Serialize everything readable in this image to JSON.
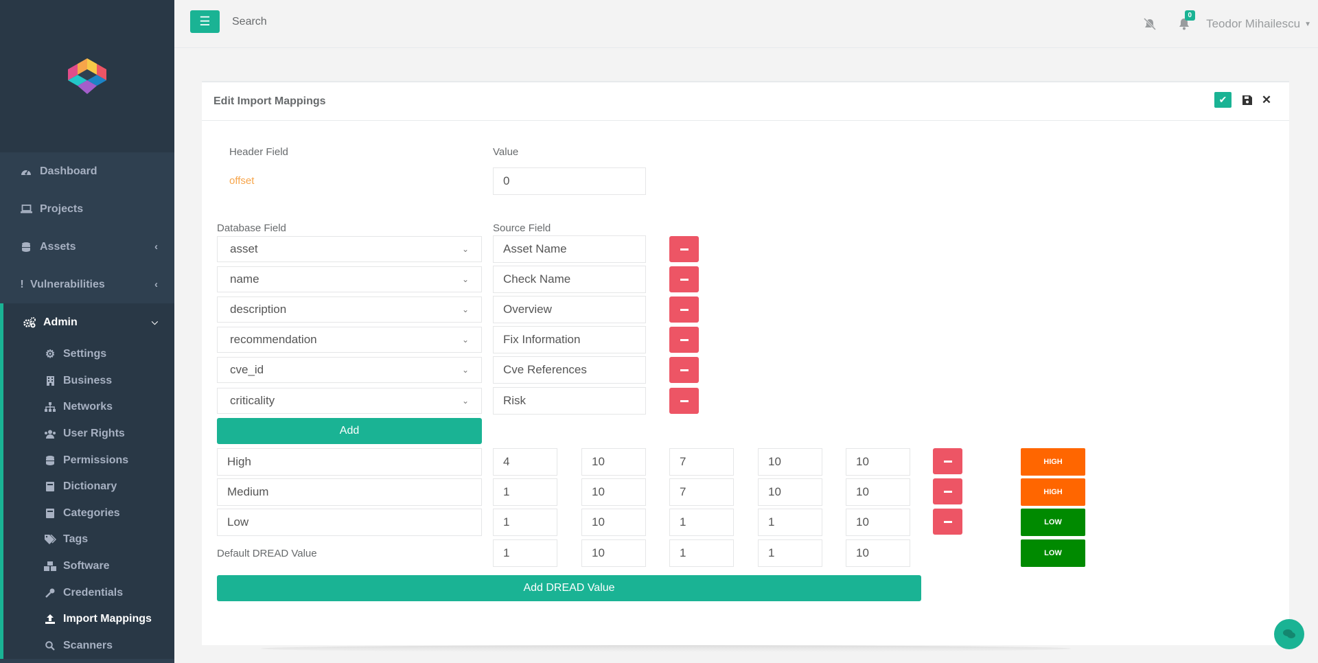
{
  "topbar": {
    "search": "Search",
    "notification_count": "0",
    "user_name": "Teodor Mihailescu"
  },
  "sidebar": {
    "items": [
      {
        "label": "Dashboard",
        "icon": "dashboard-icon"
      },
      {
        "label": "Projects",
        "icon": "laptop-icon"
      },
      {
        "label": "Assets",
        "icon": "database-icon"
      },
      {
        "label": "Vulnerabilities",
        "icon": "exclamation-icon"
      },
      {
        "label": "Admin",
        "icon": "gears-icon"
      }
    ],
    "admin_items": [
      {
        "label": "Settings",
        "icon": "gears-icon"
      },
      {
        "label": "Business",
        "icon": "building-icon"
      },
      {
        "label": "Networks",
        "icon": "sitemap-icon"
      },
      {
        "label": "User Rights",
        "icon": "users-icon"
      },
      {
        "label": "Permissions",
        "icon": "database-icon"
      },
      {
        "label": "Dictionary",
        "icon": "book-icon"
      },
      {
        "label": "Categories",
        "icon": "book-icon"
      },
      {
        "label": "Tags",
        "icon": "tags-icon"
      },
      {
        "label": "Software",
        "icon": "cubes-icon"
      },
      {
        "label": "Credentials",
        "icon": "key-icon"
      },
      {
        "label": "Import Mappings",
        "icon": "upload-icon"
      },
      {
        "label": "Scanners",
        "icon": "search-icon"
      }
    ]
  },
  "panel": {
    "title": "Edit Import Mappings",
    "header_field_label": "Header Field",
    "value_label": "Value",
    "header_field": "offset",
    "header_value": "0",
    "database_field_label": "Database Field",
    "source_field_label": "Source Field",
    "mappings": [
      {
        "db": "asset",
        "source": "Asset Name"
      },
      {
        "db": "name",
        "source": "Check Name"
      },
      {
        "db": "description",
        "source": "Overview"
      },
      {
        "db": "recommendation",
        "source": "Fix Information"
      },
      {
        "db": "cve_id",
        "source": "Cve References"
      },
      {
        "db": "criticality",
        "source": "Risk"
      }
    ],
    "add_label": "Add",
    "dread": [
      {
        "name": "High",
        "v": [
          "4",
          "10",
          "7",
          "10",
          "10"
        ],
        "level": "HIGH"
      },
      {
        "name": "Medium",
        "v": [
          "1",
          "10",
          "7",
          "10",
          "10"
        ],
        "level": "HIGH"
      },
      {
        "name": "Low",
        "v": [
          "1",
          "10",
          "1",
          "1",
          "10"
        ],
        "level": "LOW"
      }
    ],
    "default_dread_label": "Default DREAD Value",
    "default_dread": {
      "v": [
        "1",
        "10",
        "1",
        "1",
        "10"
      ],
      "level": "LOW"
    },
    "add_dread_label": "Add DREAD Value"
  },
  "colors": {
    "accent": "#1ab394",
    "danger": "#ed5565",
    "high": "#ff6600",
    "low": "#008a00"
  }
}
